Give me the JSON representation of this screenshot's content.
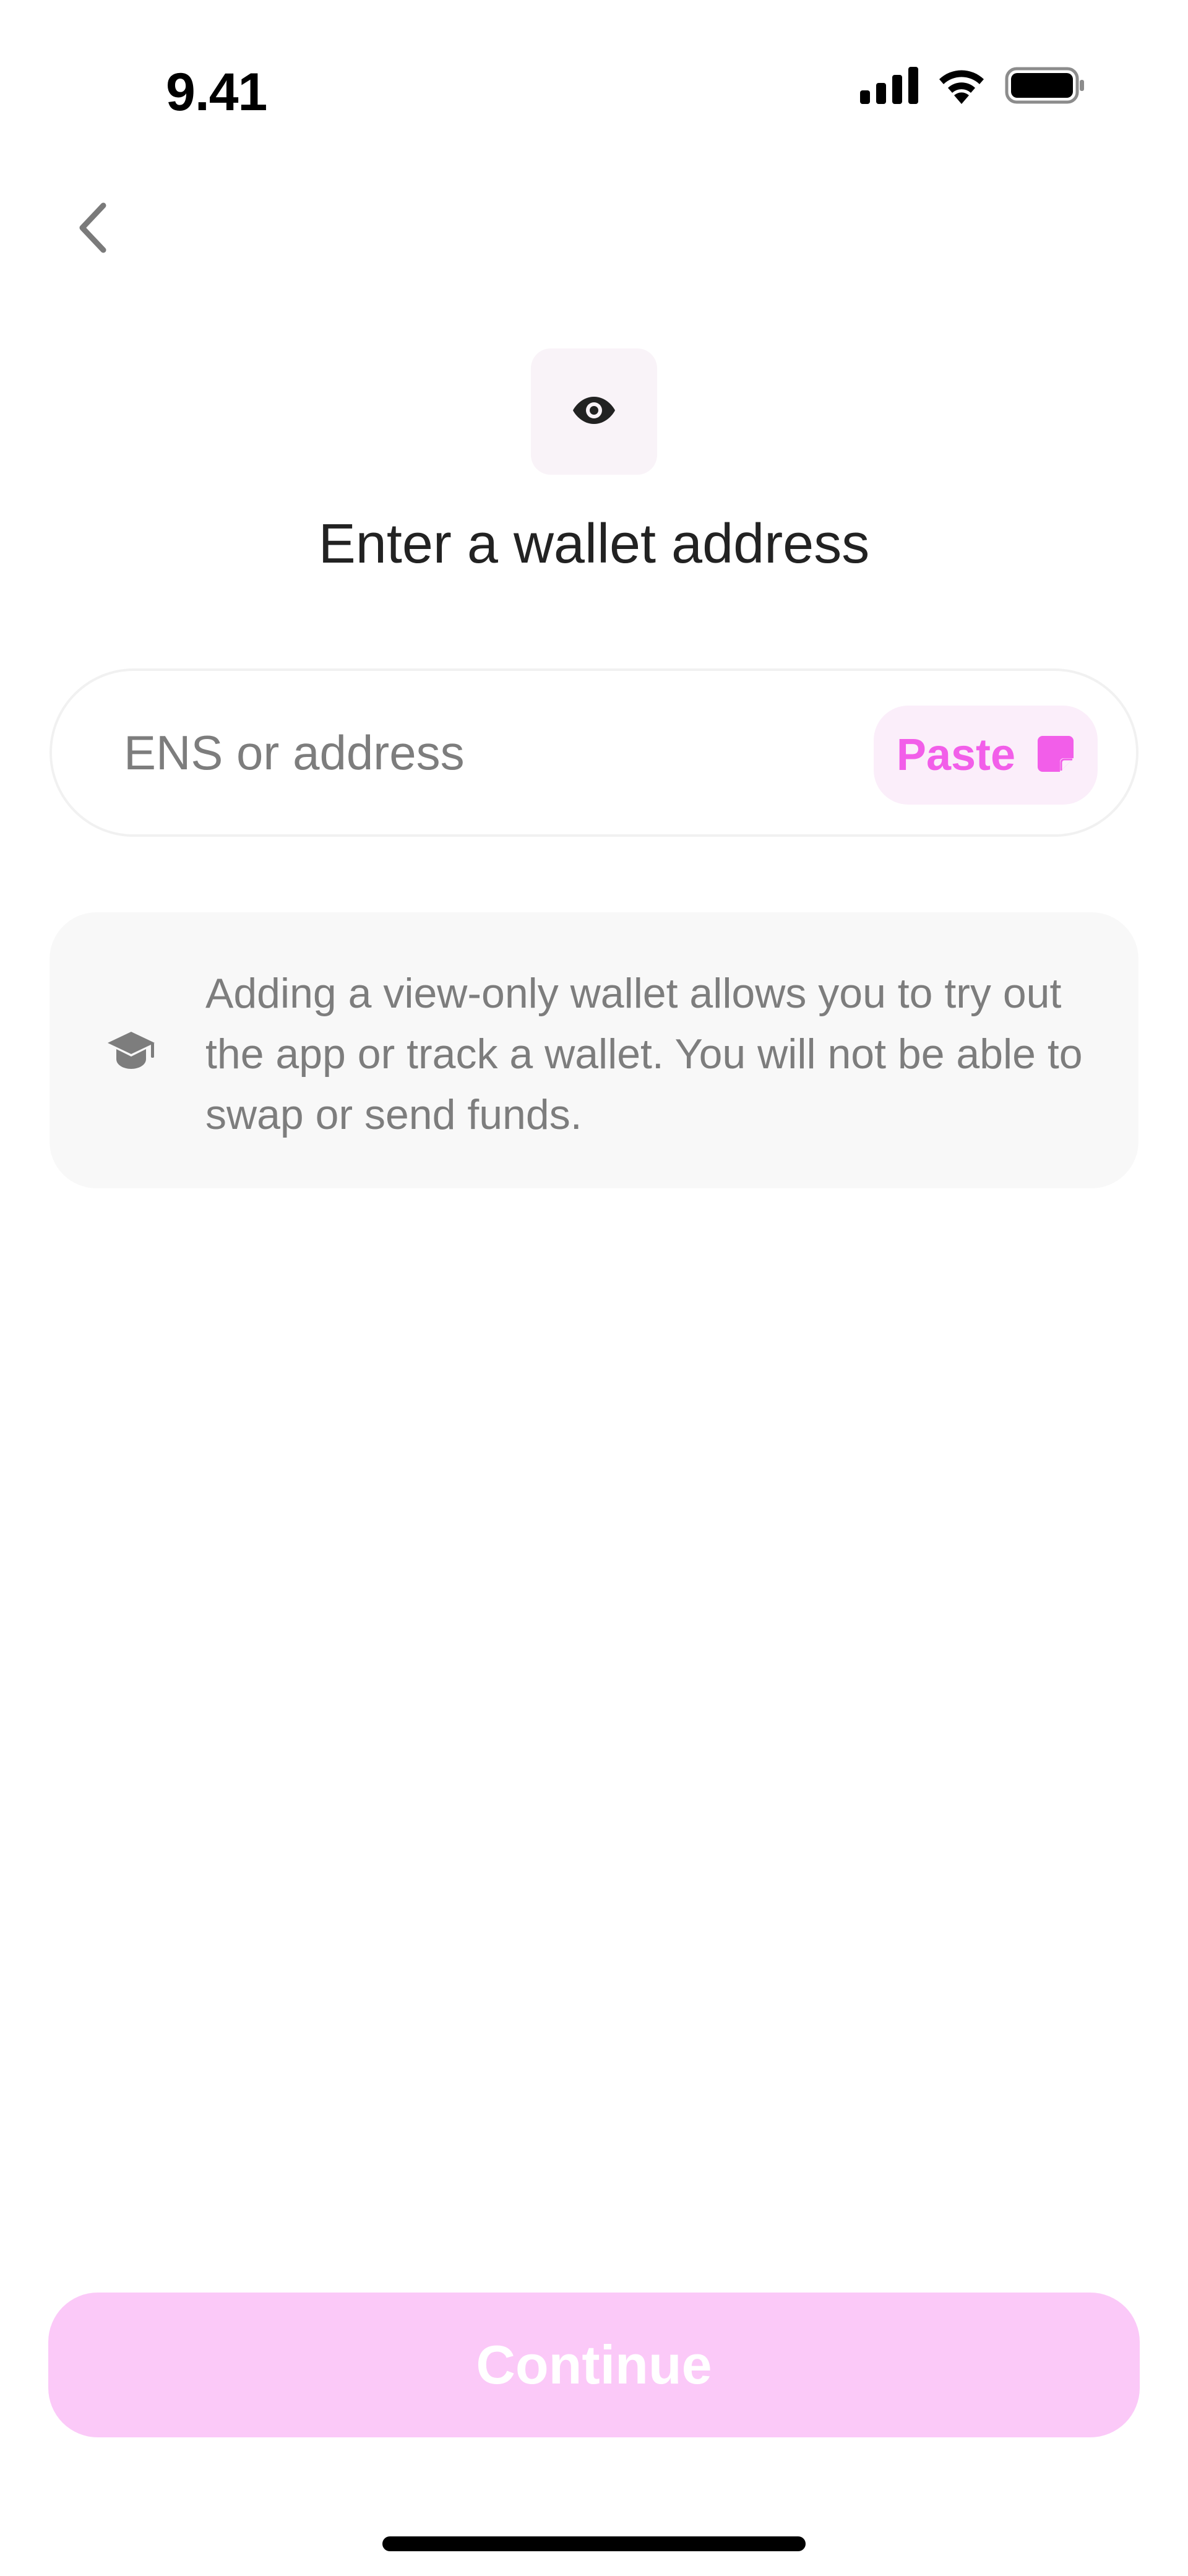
{
  "status_bar": {
    "time": "9.41",
    "icons": [
      "cellular-signal-icon",
      "wifi-icon",
      "battery-icon"
    ]
  },
  "nav": {
    "back_icon": "chevron-left-icon"
  },
  "hero": {
    "icon": "eye-icon",
    "title": "Enter a wallet address"
  },
  "address_field": {
    "value": "",
    "placeholder": "ENS or address",
    "paste_label": "Paste",
    "paste_icon": "clipboard-icon"
  },
  "info_card": {
    "icon": "graduation-cap-icon",
    "text": "Adding a view-only wallet allows you to try out the app or track a wallet. You will not be able to swap or send funds."
  },
  "footer": {
    "continue_label": "Continue",
    "continue_enabled": false
  },
  "colors": {
    "accent": "#f25ee9",
    "accent_soft": "#fbeefa",
    "button_disabled": "#fbc9f8",
    "muted_text": "#7d7d7d",
    "card_background": "#f8f8f8"
  }
}
